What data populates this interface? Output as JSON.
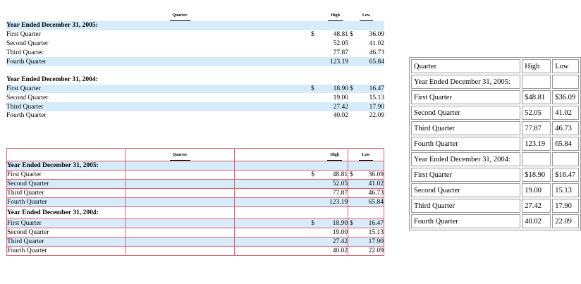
{
  "table": {
    "headers": {
      "quarter": "Quarter",
      "high": "High",
      "low": "Low"
    },
    "dollar": "$",
    "sections": [
      {
        "title": "Year Ended December 31, 2005:",
        "rows": [
          {
            "quarter": "First Quarter",
            "high": "48.81",
            "low": "36.09"
          },
          {
            "quarter": "Second Quarter",
            "high": "52.05",
            "low": "41.02"
          },
          {
            "quarter": "Third Quarter",
            "high": "77.87",
            "low": "46.73"
          },
          {
            "quarter": "Fourth Quarter",
            "high": "123.19",
            "low": "65.84"
          }
        ]
      },
      {
        "title": "Year Ended December 31, 2004:",
        "rows": [
          {
            "quarter": "First Quarter",
            "high": "18.90",
            "low": "16.47"
          },
          {
            "quarter": "Second Quarter",
            "high": "19.00",
            "low": "15.13"
          },
          {
            "quarter": "Third Quarter",
            "high": "27.42",
            "low": "17.90"
          },
          {
            "quarter": "Fourth Quarter",
            "high": "40.02",
            "low": "22.09"
          }
        ]
      }
    ]
  },
  "plain_table": {
    "headers": {
      "quarter": "Quarter",
      "high": "High",
      "low": "Low"
    },
    "sections": [
      {
        "title": "Year Ended December 31, 2005:",
        "rows": [
          {
            "quarter": "First Quarter",
            "high": "$48.81",
            "low": "$36.09"
          },
          {
            "quarter": "Second Quarter",
            "high": "52.05",
            "low": "41.02"
          },
          {
            "quarter": "Third Quarter",
            "high": "77.87",
            "low": "46.73"
          },
          {
            "quarter": "Fourth Quarter",
            "high": "123.19",
            "low": "65.84"
          }
        ]
      },
      {
        "title": "Year Ended December 31, 2004:",
        "rows": [
          {
            "quarter": "First Quarter",
            "high": "$18.90",
            "low": "$16.47"
          },
          {
            "quarter": "Second Quarter",
            "high": "19.00",
            "low": "15.13"
          },
          {
            "quarter": "Third Quarter",
            "high": "27.42",
            "low": "17.90"
          },
          {
            "quarter": "Fourth Quarter",
            "high": "40.02",
            "low": "22.09"
          }
        ]
      }
    ]
  }
}
